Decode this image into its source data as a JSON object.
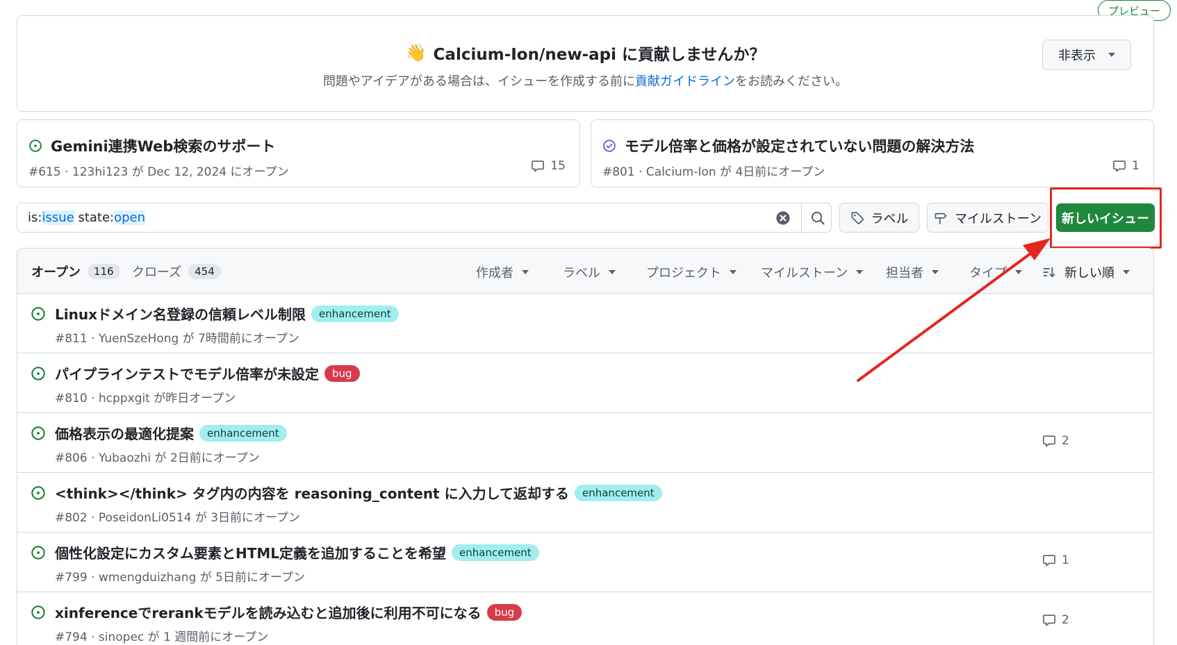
{
  "preview_badge": "プレビュー",
  "banner": {
    "emoji": "👋",
    "title": "Calcium-Ion/new-api に貢献しませんか？",
    "sub_prefix": "問題やアイデアがある場合は、イシューを作成する前に",
    "sub_link": "貢献ガイドライン",
    "sub_suffix": "をお読みください。",
    "hide_label": "非表示"
  },
  "pinned": [
    {
      "title": "Gemini連携Web検索のサポート",
      "meta": "#615 · 123hi123 が Dec 12, 2024 にオープン",
      "comments": "15",
      "state": "open"
    },
    {
      "title": "モデル倍率と価格が設定されていない問題の解決方法",
      "meta": "#801 · Calcium-Ion が 4日前にオープン",
      "comments": "1",
      "state": "closed"
    }
  ],
  "search": {
    "qualifier1_key": "is:",
    "qualifier1_val": "issue",
    "qualifier2_key": "state:",
    "qualifier2_val": "open"
  },
  "toolbar": {
    "labels_label": "ラベル",
    "milestones_label": "マイルストーン",
    "new_issue_label": "新しいイシュー"
  },
  "list_header": {
    "open_label": "オープン",
    "open_count": "116",
    "closed_label": "クローズ",
    "closed_count": "454",
    "filters": [
      "作成者",
      "ラベル",
      "プロジェクト",
      "マイルストーン",
      "担当者",
      "タイプ"
    ],
    "sort_label": "新しい順"
  },
  "issues": [
    {
      "title": "Linuxドメイン名登録の信頼レベル制限",
      "label": "enhancement",
      "meta": "#811 · YuenSzeHong が 7時間前にオープン",
      "comments": ""
    },
    {
      "title": "パイプラインテストでモデル倍率が未設定",
      "label": "bug",
      "meta": "#810 · hcppxgit が昨日オープン",
      "comments": ""
    },
    {
      "title": "価格表示の最適化提案",
      "label": "enhancement",
      "meta": "#806 · Yubaozhi が 2日前にオープン",
      "comments": "2"
    },
    {
      "title": "<think></think> タグ内の内容を reasoning_content に入力して返却する",
      "label": "enhancement",
      "meta": "#802 · PoseidonLi0514 が 3日前にオープン",
      "comments": ""
    },
    {
      "title": "個性化設定にカスタム要素とHTML定義を追加することを希望",
      "label": "enhancement",
      "meta": "#799 · wmengduizhang が 5日前にオープン",
      "comments": "1"
    },
    {
      "title": "xinferenceでrerankモデルを読み込むと追加後に利用不可になる",
      "label": "bug",
      "meta": "#794 · sinopec が 1 週間前にオープン",
      "comments": "2"
    }
  ],
  "colors": {
    "primary_green": "#1f883d",
    "open_icon": "#1a7f37",
    "closed_icon": "#8250df",
    "annotation_red": "#e5261f",
    "enhancement_bg": "#a2eeef",
    "bug_bg": "#d73a4a"
  },
  "icons": {
    "open_issue": "issue-opened-icon",
    "closed_issue": "issue-closed-icon",
    "comment": "comment-icon",
    "tag": "tag-icon",
    "milestone": "milestone-icon",
    "search": "search-icon",
    "clear": "x-circle-icon",
    "sort": "sort-desc-icon"
  }
}
